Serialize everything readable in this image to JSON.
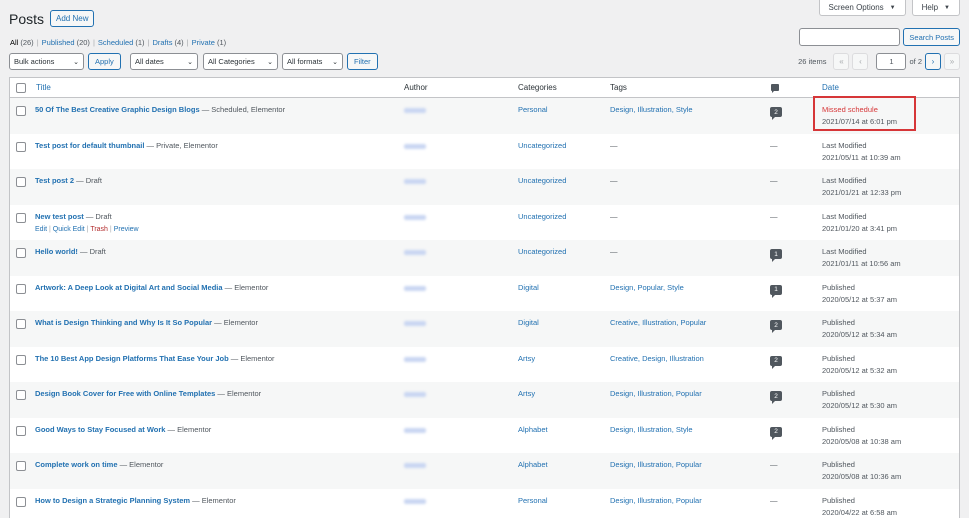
{
  "header": {
    "title": "Posts",
    "add_new": "Add New"
  },
  "top_buttons": {
    "screen_options": "Screen Options",
    "help": "Help"
  },
  "filters": [
    {
      "label": "All",
      "count": "(26)",
      "current": true
    },
    {
      "label": "Published",
      "count": "(20)"
    },
    {
      "label": "Scheduled",
      "count": "(1)"
    },
    {
      "label": "Drafts",
      "count": "(4)"
    },
    {
      "label": "Private",
      "count": "(1)"
    }
  ],
  "search": {
    "button": "Search Posts",
    "placeholder": ""
  },
  "toolbar": {
    "bulk_actions": "Bulk actions",
    "apply": "Apply",
    "dates": "All dates",
    "categories": "All Categories",
    "formats": "All formats",
    "filter": "Filter"
  },
  "pagination": {
    "items": "26 items",
    "first": "«",
    "prev": "‹",
    "current_page": "1",
    "of_pages": "of 2",
    "next": "›",
    "last": "»"
  },
  "columns": {
    "title": "Title",
    "author": "Author",
    "categories": "Categories",
    "tags": "Tags",
    "date": "Date"
  },
  "rows": [
    {
      "title": "50 Of The Best Creative Graphic Design Blogs",
      "state": " — Scheduled, Elementor",
      "category": "Personal",
      "tags": "Design, Illustration, Style",
      "comments": "2",
      "date_status": "Missed schedule",
      "date_value": "2021/07/14 at 6:01 pm"
    },
    {
      "title": "Test post for default thumbnail",
      "state": " — Private, Elementor",
      "category": "Uncategorized",
      "tags": "—",
      "comments": "—",
      "date_status": "Last Modified",
      "date_value": "2021/05/11 at 10:39 am"
    },
    {
      "title": "Test post 2",
      "state": " — Draft",
      "category": "Uncategorized",
      "tags": "—",
      "comments": "—",
      "date_status": "Last Modified",
      "date_value": "2021/01/21 at 12:33 pm"
    },
    {
      "title": "New test post",
      "state": " — Draft",
      "category": "Uncategorized",
      "tags": "—",
      "comments": "—",
      "date_status": "Last Modified",
      "date_value": "2021/01/20 at 3:41 pm"
    },
    {
      "title": "Hello world!",
      "state": " — Draft",
      "category": "Uncategorized",
      "tags": "—",
      "comments": "1",
      "date_status": "Last Modified",
      "date_value": "2021/01/11 at 10:56 am"
    },
    {
      "title": "Artwork: A Deep Look at Digital Art and Social Media",
      "state": " — Elementor",
      "category": "Digital",
      "tags": "Design, Popular, Style",
      "comments": "1",
      "date_status": "Published",
      "date_value": "2020/05/12 at 5:37 am"
    },
    {
      "title": "What is Design Thinking and Why Is It So Popular",
      "state": " — Elementor",
      "category": "Digital",
      "tags": "Creative, Illustration, Popular",
      "comments": "2",
      "date_status": "Published",
      "date_value": "2020/05/12 at 5:34 am"
    },
    {
      "title": "The 10 Best App Design Platforms That Ease Your Job",
      "state": " — Elementor",
      "category": "Artsy",
      "tags": "Creative, Design, Illustration",
      "comments": "2",
      "date_status": "Published",
      "date_value": "2020/05/12 at 5:32 am"
    },
    {
      "title": "Design Book Cover for Free with Online Templates",
      "state": " — Elementor",
      "category": "Artsy",
      "tags": "Design, Illustration, Popular",
      "comments": "2",
      "date_status": "Published",
      "date_value": "2020/05/12 at 5:30 am"
    },
    {
      "title": "Good Ways to Stay Focused at Work",
      "state": " — Elementor",
      "category": "Alphabet",
      "tags": "Design, Illustration, Style",
      "comments": "2",
      "date_status": "Published",
      "date_value": "2020/05/08 at 10:38 am"
    },
    {
      "title": "Complete work on time",
      "state": " — Elementor",
      "category": "Alphabet",
      "tags": "Design, Illustration, Popular",
      "comments": "—",
      "date_status": "Published",
      "date_value": "2020/05/08 at 10:36 am"
    },
    {
      "title": "How to Design a Strategic Planning System",
      "state": " — Elementor",
      "category": "Personal",
      "tags": "Design, Illustration, Popular",
      "comments": "—",
      "date_status": "Published",
      "date_value": "2020/04/22 at 6:58 am"
    }
  ],
  "row_actions": {
    "edit": "Edit",
    "quick_edit": "Quick Edit",
    "trash": "Trash",
    "preview": "Preview",
    "sep": "|"
  }
}
